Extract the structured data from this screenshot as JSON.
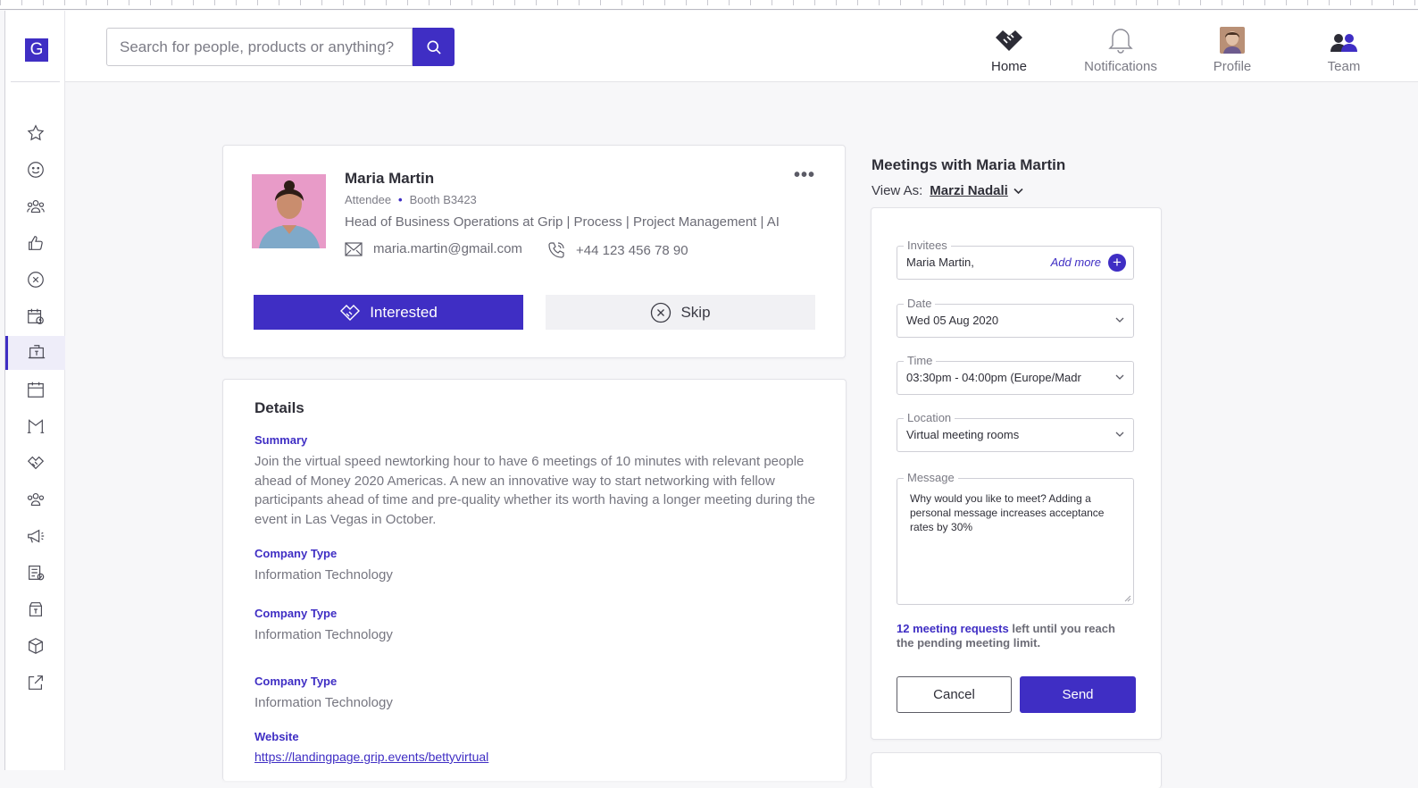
{
  "search": {
    "placeholder": "Search for people, products or anything?"
  },
  "logo": {
    "letter": "G"
  },
  "top_nav": [
    {
      "label": "Home",
      "icon": "handshake-icon"
    },
    {
      "label": "Notifications",
      "icon": "bell-icon"
    },
    {
      "label": "Profile",
      "icon": "avatar"
    },
    {
      "label": "Team",
      "icon": "team-icon"
    }
  ],
  "sidebar": {
    "items": [
      "star-icon",
      "smiley-icon",
      "group-icon",
      "thumbs-up-icon",
      "close-circle-icon",
      "calendar-clock-icon",
      "exhibitor-icon",
      "calendar-icon",
      "gate-icon",
      "handshake-icon",
      "people-icon",
      "megaphone-icon",
      "checklist-icon",
      "package-icon",
      "box-icon",
      "external-link-icon"
    ],
    "active_index": 6
  },
  "profile": {
    "name": "Maria Martin",
    "role": "Attendee",
    "booth": "Booth B3423",
    "headline": "Head of Business Operations at Grip | Process | Project Management | AI",
    "email": "maria.martin@gmail.com",
    "phone": "+44 123 456 78 90",
    "interested_label": "Interested",
    "skip_label": "Skip",
    "more": "•••"
  },
  "details": {
    "title": "Details",
    "summary_label": "Summary",
    "summary": "Join the virtual speed newtorking hour to have 6 meetings of 10 minutes with relevant people ahead of Money 2020 Americas. A new an innovative way to start networking with fellow participants ahead of time and pre-quality whether its worth having a longer meeting during the event in Las Vegas in October.",
    "fields": [
      {
        "label": "Company Type",
        "value": "Information Technology"
      },
      {
        "label": "Company Type",
        "value": "Information Technology"
      },
      {
        "label": "Company Type",
        "value": "Information Technology"
      }
    ],
    "website_label": "Website",
    "website": "https://landingpage.grip.events/bettyvirtual"
  },
  "meetings": {
    "title": "Meetings with Maria Martin",
    "view_as_label": "View As:",
    "view_as": "Marzi Nadali",
    "invitees_label": "Invitees",
    "invitees": "Maria Martin,",
    "add_more": "Add more",
    "date_label": "Date",
    "date": "Wed 05 Aug 2020",
    "time_label": "Time",
    "time": "03:30pm - 04:00pm (Europe/Madr",
    "location_label": "Location",
    "location": "Virtual meeting rooms",
    "message_label": "Message",
    "message": "Why would you like to meet? Adding a personal message increases acceptance rates by 30%",
    "limit_highlight": "12 meeting requests",
    "limit_rest": " left until you reach the pending meeting limit.",
    "cancel_label": "Cancel",
    "send_label": "Send"
  },
  "colors": {
    "accent": "#3f2ec4",
    "background": "#f7f7f9"
  }
}
